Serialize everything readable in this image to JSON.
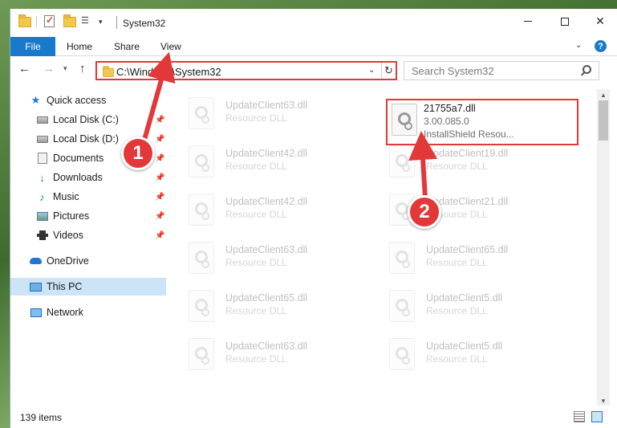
{
  "window": {
    "title": "System32",
    "quick_access_dropdown": "▾"
  },
  "ribbon": {
    "tabs": [
      "File",
      "Home",
      "Share",
      "View"
    ],
    "help": "?"
  },
  "navigation": {
    "address": "C:\\Windows\\System32",
    "search_placeholder": "Search System32"
  },
  "sidebar": {
    "items": [
      {
        "label": "Quick access",
        "icon": "star-icon",
        "pinned": false
      },
      {
        "label": "Local Disk (C:)",
        "icon": "disk-icon",
        "pinned": true
      },
      {
        "label": "Local Disk (D:)",
        "icon": "disk-icon",
        "pinned": true
      },
      {
        "label": "Documents",
        "icon": "documents-icon",
        "pinned": true
      },
      {
        "label": "Downloads",
        "icon": "downloads-icon",
        "pinned": true
      },
      {
        "label": "Music",
        "icon": "music-icon",
        "pinned": true
      },
      {
        "label": "Pictures",
        "icon": "pictures-icon",
        "pinned": true
      },
      {
        "label": "Videos",
        "icon": "videos-icon",
        "pinned": true
      },
      {
        "label": "OneDrive",
        "icon": "onedrive-icon",
        "pinned": false
      },
      {
        "label": "This PC",
        "icon": "this-pc-icon",
        "pinned": false,
        "selected": true
      },
      {
        "label": "Network",
        "icon": "network-icon",
        "pinned": false
      }
    ]
  },
  "files": {
    "highlighted": {
      "name": "21755a7.dll",
      "version": "3.00.085.0",
      "description": "InstallShield Resou..."
    },
    "left_column": [
      {
        "name": "UpdateClient63.dll",
        "type": "Resource DLL"
      },
      {
        "name": "UpdateClient42.dll",
        "type": "Resource DLL"
      },
      {
        "name": "UpdateClient42.dll",
        "type": "Resource DLL"
      },
      {
        "name": "UpdateClient63.dll",
        "type": "Resource DLL"
      },
      {
        "name": "UpdateClient65.dll",
        "type": "Resource DLL"
      },
      {
        "name": "UpdateClient63.dll",
        "type": "Resource DLL"
      }
    ],
    "right_column": [
      {
        "name": "UpdateClient19.dll",
        "type": "Resource DLL"
      },
      {
        "name": "UpdateClient21.dll",
        "type": "Resource DLL"
      },
      {
        "name": "UpdateClient65.dll",
        "type": "Resource DLL"
      },
      {
        "name": "UpdateClient5.dll",
        "type": "Resource DLL"
      },
      {
        "name": "UpdateClient5.dll",
        "type": "Resource DLL"
      }
    ]
  },
  "status": {
    "item_count": "139 items"
  },
  "annotations": {
    "step1": "1",
    "step2": "2",
    "color": "#e2383a"
  }
}
